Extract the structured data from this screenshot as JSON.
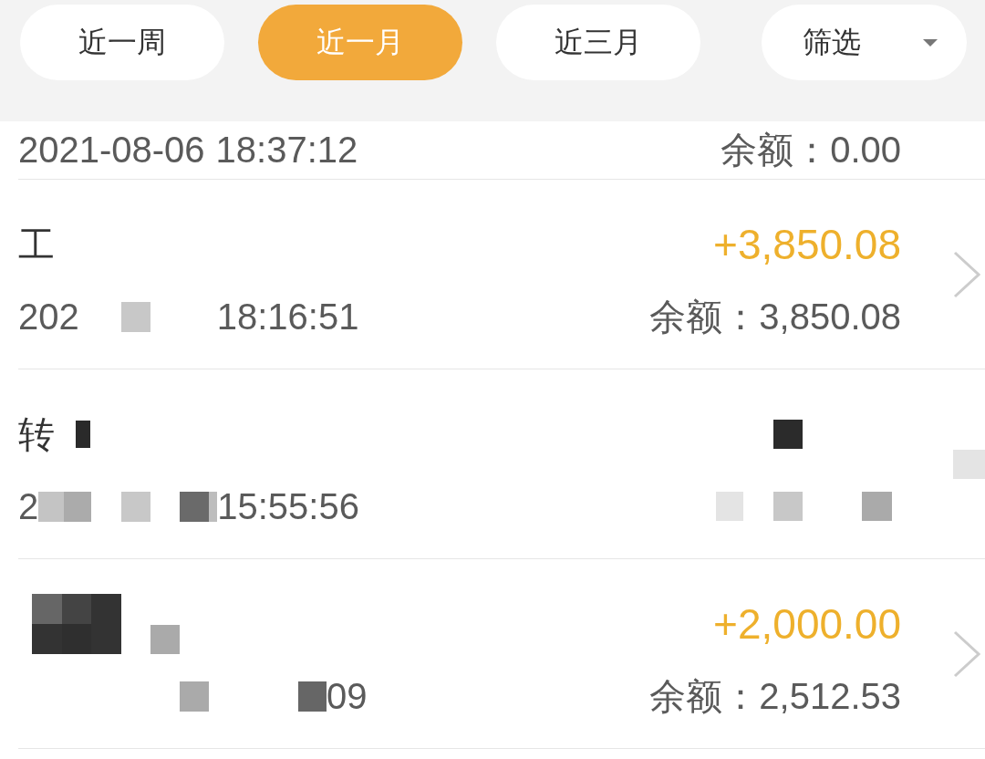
{
  "filter_tabs": [
    {
      "label": "近一周",
      "selected": false
    },
    {
      "label": "近一月",
      "selected": true
    },
    {
      "label": "近三月",
      "selected": false
    }
  ],
  "filter_dropdown": {
    "label": "筛选"
  },
  "transactions": [
    {
      "kind": "partial",
      "date": "2021-08-06",
      "time": "18:37:12",
      "balance": "余额：0.00"
    },
    {
      "kind": "full",
      "title": "工",
      "amount": "+3,850.08",
      "date": "202",
      "date_mask": {
        "kind": "single"
      },
      "time": "18:16:51",
      "balance": "余额：3,850.08",
      "chevron": true
    },
    {
      "kind": "full",
      "title": "转",
      "title_mask": {
        "kind": "small"
      },
      "amount_mask": {
        "kind": "block"
      },
      "date": "2",
      "date_mask": {
        "kind": "mixed"
      },
      "time": "15:55:56",
      "balance_mask": {
        "kind": "row"
      },
      "chevron": false,
      "chevron_mask": {
        "kind": "tile"
      }
    },
    {
      "kind": "full",
      "title_mask": {
        "kind": "large"
      },
      "amount": "+2,000.00",
      "date_mask": {
        "kind": "sparse"
      },
      "time": "09",
      "balance": "余额：2,512.53",
      "chevron": true
    }
  ]
}
